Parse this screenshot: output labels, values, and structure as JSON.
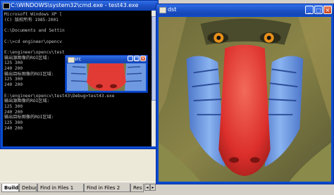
{
  "cmd_window": {
    "title": "C:\\WINDOWS\\system32\\cmd.exe - test43.exe",
    "lines": [
      "Microsoft Windows XP [",
      "(C) 版权所有 1985-2001",
      "",
      "C:\\Documents and Settin",
      "",
      "C:\\>cd engineer\\opencv",
      "",
      "E:\\engineer\\opencv\\test",
      "输出源图像的ROI区域:",
      "125 300",
      "240 200",
      "输出目标图像的ROI区域:",
      "125 300",
      "240 200",
      "",
      "E:\\engineer\\opencv\\test43\\Debug>test43.exe",
      "输出源图像的ROI区域:",
      "125 300",
      "240 200",
      "输出目标图像的ROI区域:",
      "125 300",
      "240 200"
    ]
  },
  "src_window": {
    "title": "src"
  },
  "dst_window": {
    "title": "dst"
  },
  "title_buttons": {
    "minimize": "_",
    "maximize": "□",
    "close": "×"
  },
  "output_tabs": [
    {
      "label": "Build",
      "active": true
    },
    {
      "label": "Debug",
      "active": false
    },
    {
      "label": "Find in Files 1",
      "active": false
    },
    {
      "label": "Find in Files 2",
      "active": false
    },
    {
      "label": "Res",
      "active": false
    }
  ],
  "tab_scroll": {
    "left": "◂",
    "right": "▸"
  },
  "colors": {
    "titlebar": "#2150d8",
    "console_bg": "#000000",
    "console_text": "#c0c0c0",
    "mandrill_nose": "#e23b36",
    "mandrill_cheek": "#6e9ee8"
  }
}
